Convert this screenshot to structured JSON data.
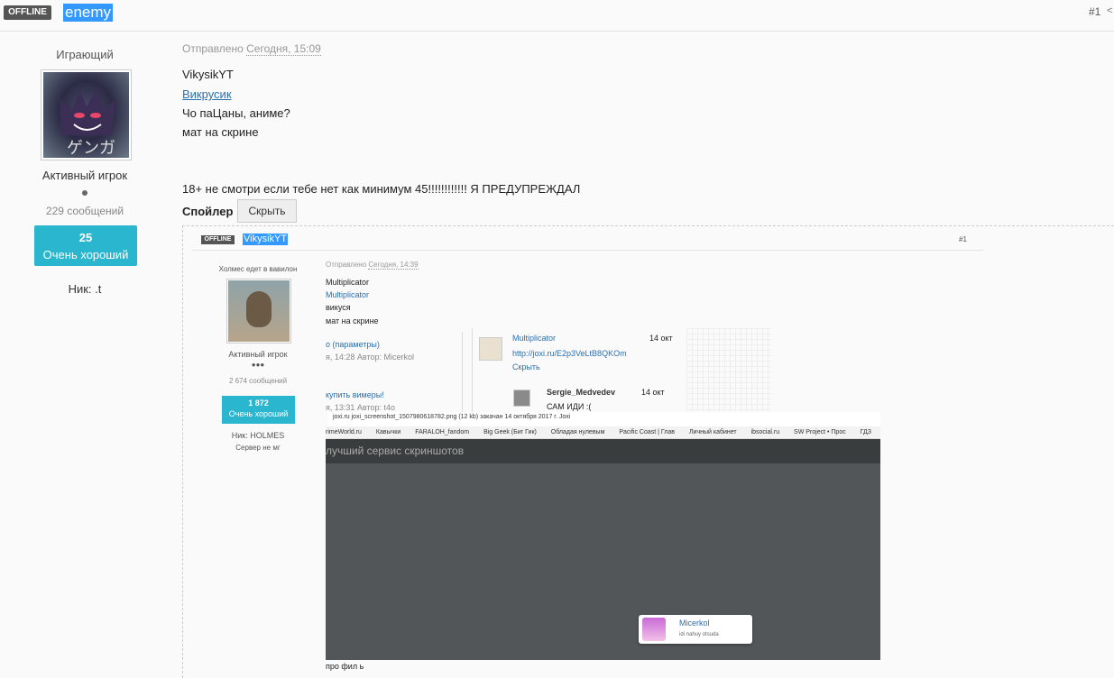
{
  "header": {
    "status_badge": "OFFLINE",
    "username": "enemy",
    "post_number": "#1",
    "share_icon": "share-icon"
  },
  "author": {
    "title": "Играющий",
    "rank": "Активный игрок",
    "posts": "229 сообщений",
    "reputation_value": "25",
    "reputation_label": "Очень хороший",
    "nick": "Ник: .t"
  },
  "post": {
    "sent_label": "Отправлено",
    "sent_date": "Сегодня, 15:09",
    "lines": [
      "VikysikYT",
      "Викрусик",
      "Чо паЦаны, аниме?",
      "мат на скрине",
      "18+ не смотри если тебе нет как минимум 45!!!!!!!!!!!! Я ПРЕДУПРЕЖДАЛ"
    ],
    "spoiler_label": "Спойлер",
    "hide_button": "Скрыть"
  },
  "screenshot": {
    "status_badge": "OFFLINE",
    "username": "VikysikYT",
    "post_number": "#1",
    "author_title": "Холмес едет в вавилон",
    "author_rank": "Активный игрок",
    "author_dots": "●●●",
    "author_posts": "2 674 сообщений",
    "rep_value": "1 872",
    "rep_label": "Очень хороший",
    "nick": "Ник: HOLMES",
    "server": "Сервер не мг",
    "sent_label": "Отправлено",
    "sent_date": "Сегодня, 14:39",
    "lines": [
      "Multiplicator",
      "Multiplicator",
      "викуся",
      "мат на скрине"
    ],
    "left_panel": {
      "item1": "о (параметры)",
      "item1_meta": "я, 14:28 Автор: Micerkol",
      "item2": "купить вимеры!",
      "item2_meta": "я, 13:31 Автор: t4o"
    },
    "right_panel": {
      "name1": "Multiplicator",
      "date1": "14 окт",
      "link1": "http://joxi.ru/E2p3VeLtB8QKOm",
      "hide1": "Скрыть",
      "name2": "Sergie_Medvedev",
      "date2": "14 окт",
      "text2": "САМ ИДИ :("
    },
    "download_bar": "joxi.ru    joxi_screenshot_1507980618782.png (12 kb) закачан 14 октября 2017 г. Joxi",
    "bookmarks": [
      "rimeWorld.ru",
      "Кавычки",
      "FARALOH_fandom",
      "Big Geek (Биг Гик)",
      "Обладая нулевым",
      "Pacific Coast | Глав",
      "Личный кабинет",
      "ibsocial.ru",
      "SW Project • Прос",
      "ГДЗ"
    ],
    "joxi_header": "лучший сервис скриншотов",
    "card_name": "Micerkol",
    "card_sub": "idi nahuy otsuda",
    "footer_text": "про фил ь"
  }
}
